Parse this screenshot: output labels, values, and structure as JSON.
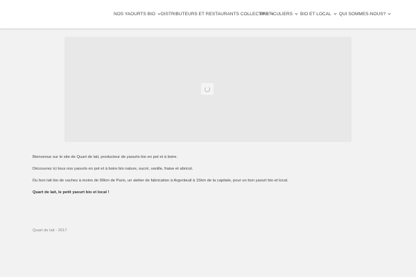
{
  "nav": {
    "items": [
      {
        "label": "Nos yaourts bio"
      },
      {
        "label": "Distributeurs et restaurants collectifs"
      },
      {
        "label": "Particuliers"
      },
      {
        "label": "Bio et local"
      },
      {
        "label": "Qui sommes-nous?"
      }
    ]
  },
  "content": {
    "paragraphs": [
      "Bienvenue sur le site de Quart de lait, producteur de yaourts bio en pot et à boire.",
      "Découvrez ici tous nos yaourts en pot et à boire bio nature, sucré, vanille, fraise et abricot.",
      "Du bon lait bio de vaches à moins de 90km de Paris, un atelier de fabrication à Argenteuil à 15km de la capitale, pour un bon yaourt bio et local."
    ],
    "tagline": "Quart de lait, le petit yaourt bio et local !"
  },
  "footer": {
    "copyright": "Quart de lait - 2017"
  }
}
